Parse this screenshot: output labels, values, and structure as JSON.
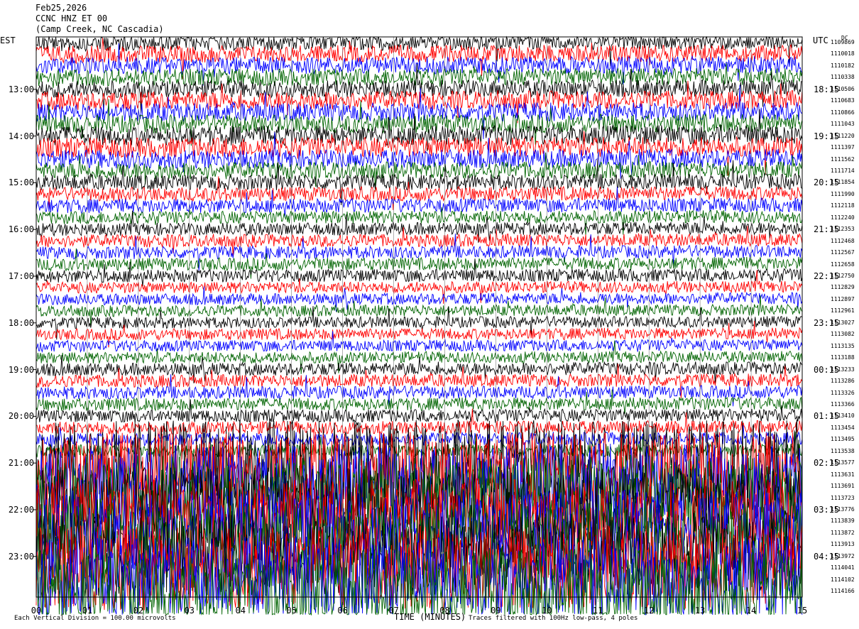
{
  "header": {
    "date": "Feb25,2026",
    "station": "CCNC HNZ ET 00",
    "location": "(Camp Creek, NC Cascadia)"
  },
  "left_timezone": "EST",
  "right_timezone": "UTC",
  "dc_label": "DC",
  "footer": {
    "xlabel": "TIME (MINUTES)",
    "left_note": "Each Vertical Division = 100.00 microvolts",
    "right_note": "Traces filtered with 100Hz low-pass, 4 poles"
  },
  "chart_data": {
    "type": "line",
    "title": "CCNC HNZ ET 00",
    "xlabel": "TIME (MINUTES)",
    "xlim": [
      0,
      15
    ],
    "x_ticks": [
      "00",
      "01",
      "02",
      "03",
      "04",
      "05",
      "06",
      "07",
      "08",
      "09",
      "10",
      "11",
      "12",
      "13",
      "14",
      "15"
    ],
    "left_hour_labels": [
      "13:00",
      "14:00",
      "15:00",
      "16:00",
      "17:00",
      "18:00",
      "19:00",
      "20:00",
      "21:00",
      "22:00",
      "23:00"
    ],
    "right_hour_labels": [
      "18:15",
      "19:15",
      "20:15",
      "21:15",
      "22:15",
      "23:15",
      "00:15",
      "01:15",
      "02:15",
      "03:15",
      "04:15"
    ],
    "trace_colors": [
      "#000000",
      "#ff0000",
      "#0000ff",
      "#006400"
    ],
    "trace_count": 48,
    "dc_offsets": [
      "1109869",
      "1110018",
      "1110182",
      "1110338",
      "1110506",
      "1110683",
      "1110866",
      "1111043",
      "1111220",
      "1111397",
      "1111562",
      "1111714",
      "1111854",
      "1111990",
      "1112118",
      "1112240",
      "1112353",
      "1112468",
      "1112567",
      "1112658",
      "1112750",
      "1112829",
      "1112897",
      "1112961",
      "1113027",
      "1113082",
      "1113135",
      "1113188",
      "1113233",
      "1113286",
      "1113326",
      "1113366",
      "1113410",
      "1113454",
      "1113495",
      "1113538",
      "1113577",
      "1113631",
      "1113691",
      "1113723",
      "1113776",
      "1113839",
      "1113872",
      "1113913",
      "1113972",
      "1114041",
      "1114102",
      "1114166"
    ],
    "amplitude_levels": [
      12,
      12,
      12,
      12,
      12,
      13,
      13,
      13,
      14,
      14,
      13,
      12,
      11,
      10,
      10,
      9,
      9,
      9,
      9,
      9,
      9,
      8,
      8,
      8,
      8,
      8,
      8,
      8,
      9,
      9,
      9,
      9,
      9,
      9,
      9,
      9,
      60,
      60,
      60,
      60,
      60,
      60,
      60,
      60,
      60,
      60,
      60,
      60
    ]
  }
}
